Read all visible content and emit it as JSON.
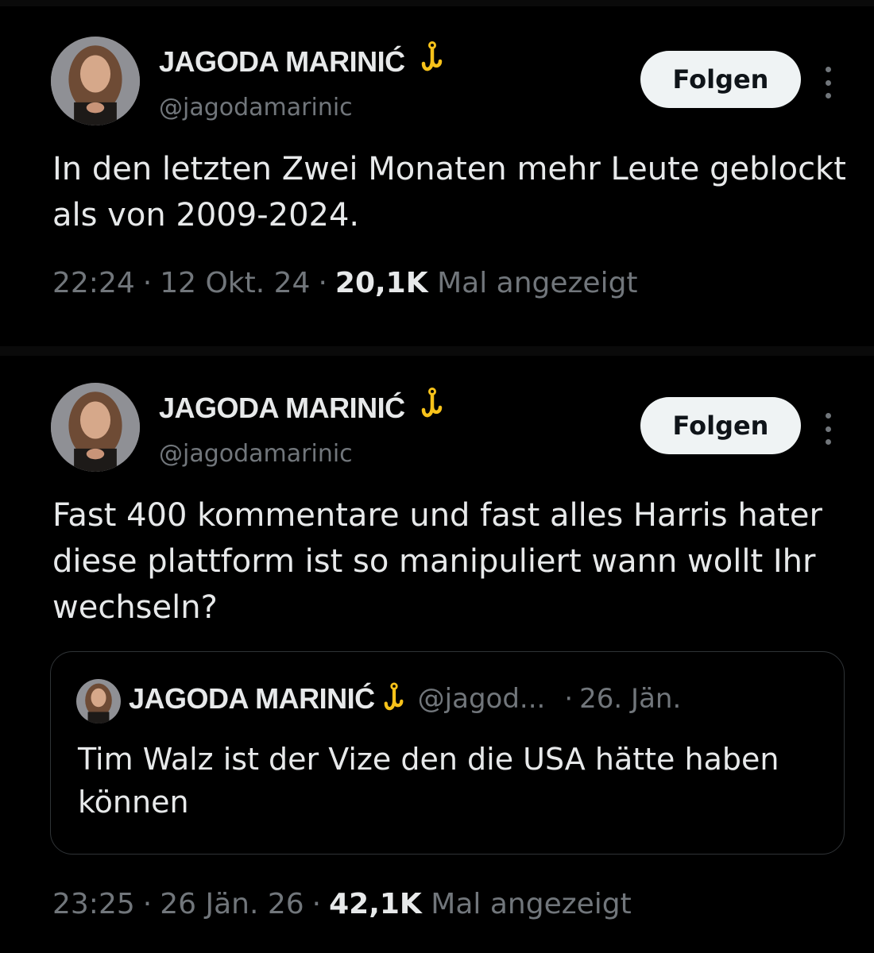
{
  "tweets": [
    {
      "author_name": "JAGODA MARINIĆ",
      "handle": "@jagodamarinic",
      "follow_label": "Folgen",
      "text": "In den letzten Zwei Monaten mehr Leute geblockt als von 2009-2024.",
      "time": "22:24",
      "date": "12 Okt. 24",
      "views": "20,1K",
      "views_label": "Mal angezeigt",
      "dot": "·"
    },
    {
      "author_name": "JAGODA MARINIĆ",
      "handle": "@jagodamarinic",
      "follow_label": "Folgen",
      "text": "Fast 400 kommentare und fast alles Harris hater diese plattform ist so manipuliert wann wollt Ihr wechseln?",
      "time": "23:25",
      "date": "26 Jän. 26",
      "views": "42,1K",
      "views_label": "Mal angezeigt",
      "dot": "·",
      "quote": {
        "author_name": "JAGODA MARINIĆ",
        "handle": "@jagod...",
        "separator": "·",
        "date": "26. Jän.",
        "text": "Tim Walz ist der Vize den die USA hätte haben können"
      }
    }
  ],
  "icons": {
    "verified_badge": "hook-icon",
    "more": "more-options-icon",
    "badge_color": "#f7c21a"
  }
}
